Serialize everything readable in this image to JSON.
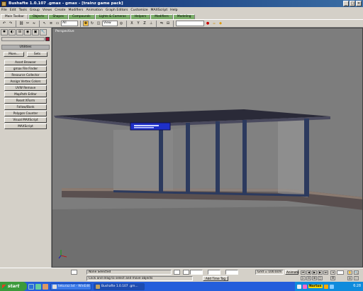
{
  "window": {
    "title": "Bushafte 1.0.107 .gmax - gmax - [trainz game pack]",
    "controls": [
      "_",
      "□",
      "×"
    ]
  },
  "menu": [
    "File",
    "Edit",
    "Tools",
    "Group",
    "Views",
    "Create",
    "Modifiers",
    "Animation",
    "Graph Editors",
    "Customize",
    "MAXScript",
    "Help"
  ],
  "tabs": [
    {
      "label": "Main Toolbar",
      "active": true
    },
    {
      "label": "Objects"
    },
    {
      "label": "Shapes"
    },
    {
      "label": "Compounds"
    },
    {
      "label": "Lights & Cameras"
    },
    {
      "label": "Helpers"
    },
    {
      "label": "Modifiers"
    },
    {
      "label": "Modeling"
    }
  ],
  "toolbar": {
    "filter_select": "All",
    "coord_select": "View"
  },
  "command_panel": {
    "rollout_title": "Utilities",
    "more_label": "More...",
    "sets_label": "Sets",
    "utilities": [
      "Asset Browser",
      "gmax File Finder",
      "Resource Collector",
      "Assign Vertex Colors",
      "UVW Remove",
      "MapPath Editor",
      "Reset XForm",
      "Follow/Bank",
      "Polygon Counter",
      "Visual MAXScript",
      "MAXScript"
    ]
  },
  "viewport": {
    "label": "Perspective",
    "colors": {
      "background": "#7d7d7d",
      "roof": "#3a3a4a",
      "frame": "#2c3a5e",
      "glass": "#8f9090",
      "sign": "#1e30c8",
      "platform": "#5a5050"
    }
  },
  "status": {
    "selection": "None Selected",
    "prompt": "Click and drag to select and move objects",
    "add_time_tag": "Add Time Tag",
    "grid": "Grid = 100.0cm",
    "animate": "Animate"
  },
  "taskbar": {
    "start_label": "start",
    "tasks": [
      {
        "label": "tekuraz.txt - WinEdit"
      },
      {
        "label": "Bushafte 1.0.107 .gm..."
      }
    ],
    "tray_app": "Norton",
    "clock": "6:28"
  }
}
